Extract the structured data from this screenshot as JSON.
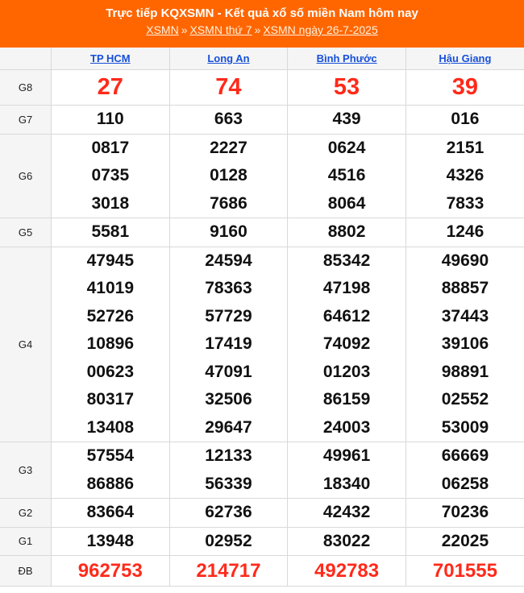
{
  "header": {
    "title": "Trực tiếp KQXSMN - Kết quả xổ số miền Nam hôm nay",
    "breadcrumbs": [
      "XSMN",
      "XSMN thứ 7",
      "XSMN ngày 26-7-2025"
    ],
    "separator": "»"
  },
  "provinces": [
    "TP HCM",
    "Long An",
    "Bình Phước",
    "Hậu Giang"
  ],
  "prizes": [
    {
      "label": "G8",
      "kind": "g8",
      "results": [
        [
          "27"
        ],
        [
          "74"
        ],
        [
          "53"
        ],
        [
          "39"
        ]
      ]
    },
    {
      "label": "G7",
      "kind": "normal",
      "results": [
        [
          "110"
        ],
        [
          "663"
        ],
        [
          "439"
        ],
        [
          "016"
        ]
      ]
    },
    {
      "label": "G6",
      "kind": "normal",
      "results": [
        [
          "0817",
          "0735",
          "3018"
        ],
        [
          "2227",
          "0128",
          "7686"
        ],
        [
          "0624",
          "4516",
          "8064"
        ],
        [
          "2151",
          "4326",
          "7833"
        ]
      ]
    },
    {
      "label": "G5",
      "kind": "normal",
      "results": [
        [
          "5581"
        ],
        [
          "9160"
        ],
        [
          "8802"
        ],
        [
          "1246"
        ]
      ]
    },
    {
      "label": "G4",
      "kind": "normal",
      "results": [
        [
          "47945",
          "41019",
          "52726",
          "10896",
          "00623",
          "80317",
          "13408"
        ],
        [
          "24594",
          "78363",
          "57729",
          "17419",
          "47091",
          "32506",
          "29647"
        ],
        [
          "85342",
          "47198",
          "64612",
          "74092",
          "01203",
          "86159",
          "24003"
        ],
        [
          "49690",
          "88857",
          "37443",
          "39106",
          "98891",
          "02552",
          "53009"
        ]
      ]
    },
    {
      "label": "G3",
      "kind": "normal",
      "results": [
        [
          "57554",
          "86886"
        ],
        [
          "12133",
          "56339"
        ],
        [
          "49961",
          "18340"
        ],
        [
          "66669",
          "06258"
        ]
      ]
    },
    {
      "label": "G2",
      "kind": "normal",
      "results": [
        [
          "83664"
        ],
        [
          "62736"
        ],
        [
          "42432"
        ],
        [
          "70236"
        ]
      ]
    },
    {
      "label": "G1",
      "kind": "normal",
      "results": [
        [
          "13948"
        ],
        [
          "02952"
        ],
        [
          "83022"
        ],
        [
          "22025"
        ]
      ]
    },
    {
      "label": "ĐB",
      "kind": "db",
      "results": [
        [
          "962753"
        ],
        [
          "214717"
        ],
        [
          "492783"
        ],
        [
          "701555"
        ]
      ]
    }
  ],
  "colors": {
    "header_bg": "#ff6600",
    "highlight_red": "#ff2a1a",
    "link_blue": "#1750d8"
  }
}
